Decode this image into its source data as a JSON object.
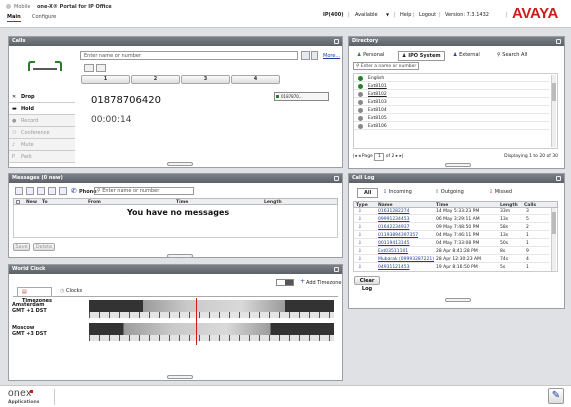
{
  "header": {
    "mobile_label": "Mobile",
    "app_title": "one-X® Portal for IP Office",
    "tabs": [
      "Main",
      "Configure"
    ],
    "status": "IP(400)",
    "availability": "Available",
    "help": "Help",
    "logout": "Logout",
    "version": "Version: 7.3.1432",
    "brand": "AVAYA"
  },
  "calls": {
    "title": "Calls",
    "input_placeholder": "Enter name or number",
    "more_label": "More...",
    "line_keys": [
      "1",
      "2",
      "3",
      "4"
    ],
    "side_buttons": [
      "Drop",
      "Hold",
      "Record",
      "Conference",
      "Mute",
      "Park"
    ],
    "number": "01878706420",
    "timer": "00:00:14",
    "mini_line": "0187870..."
  },
  "messages": {
    "title": "Messages (0 new)",
    "phone_label": "Phone",
    "search_placeholder": "Enter name or number",
    "columns": [
      "New",
      "To",
      "From",
      "Time",
      "Length"
    ],
    "empty_text": "You have no messages",
    "buttons": [
      "Save",
      "Delete"
    ]
  },
  "world_clock": {
    "title": "World Clock",
    "add_label": "Add Timezone",
    "tabs": [
      "Timezones",
      "Clocks"
    ],
    "zones": [
      {
        "city": "Amsterdam",
        "offset": "GMT +1 DST"
      },
      {
        "city": "Moscow",
        "offset": "GMT +3 DST"
      }
    ]
  },
  "directory": {
    "title": "Directory",
    "tabs": [
      "Personal",
      "IPO System",
      "External",
      "Search All"
    ],
    "search_placeholder": "Enter a name or number",
    "entries": [
      "English",
      "Ext8101",
      "Ext8102",
      "Ext8103",
      "Ext8104",
      "Ext8105",
      "Ext8106"
    ],
    "page_label": "Page",
    "page_value": "1",
    "page_of": "of 2",
    "displaying": "Displaying 1 to 20 of 30"
  },
  "call_log": {
    "title": "Call Log",
    "tabs": [
      "All",
      "Incoming",
      "Outgoing",
      "Missed"
    ],
    "columns": [
      "Type",
      "Name",
      "Time",
      "Length",
      "Calls"
    ],
    "rows": [
      {
        "name": "01631282274",
        "time": "14 May 5:33:23 PM",
        "length": "33m",
        "calls": "3"
      },
      {
        "name": "09991234453",
        "time": "06 May 3:29:11 AM",
        "length": "13s",
        "calls": "5"
      },
      {
        "name": "01642234937",
        "time": "09 May 7:48:50 PM",
        "length": "58s",
        "calls": "2"
      },
      {
        "name": "01193894397357",
        "time": "04 May 7:46:11 PM",
        "length": "13s",
        "calls": "1"
      },
      {
        "name": "00119413145",
        "time": "04 May 7:33:08 PM",
        "length": "50s",
        "calls": "1"
      },
      {
        "name": "Ext03511101",
        "time": "28 Apr 8:41:28 PM",
        "length": "8s",
        "calls": "9"
      },
      {
        "name": "Mubarak (09993287221)",
        "time": "28 Apr 12:30:23 AM",
        "length": "74s",
        "calls": "4"
      },
      {
        "name": "04931121453",
        "time": "19 Apr 8:16:50 PM",
        "length": "5s",
        "calls": "1"
      }
    ],
    "clear_label": "Clear Log"
  },
  "footer": {
    "logo": "onex",
    "sub": "Applications"
  },
  "colors": {
    "avaya_red": "#d01b1b",
    "link_blue": "#1b3e9c",
    "header_grey": "#686c73"
  }
}
